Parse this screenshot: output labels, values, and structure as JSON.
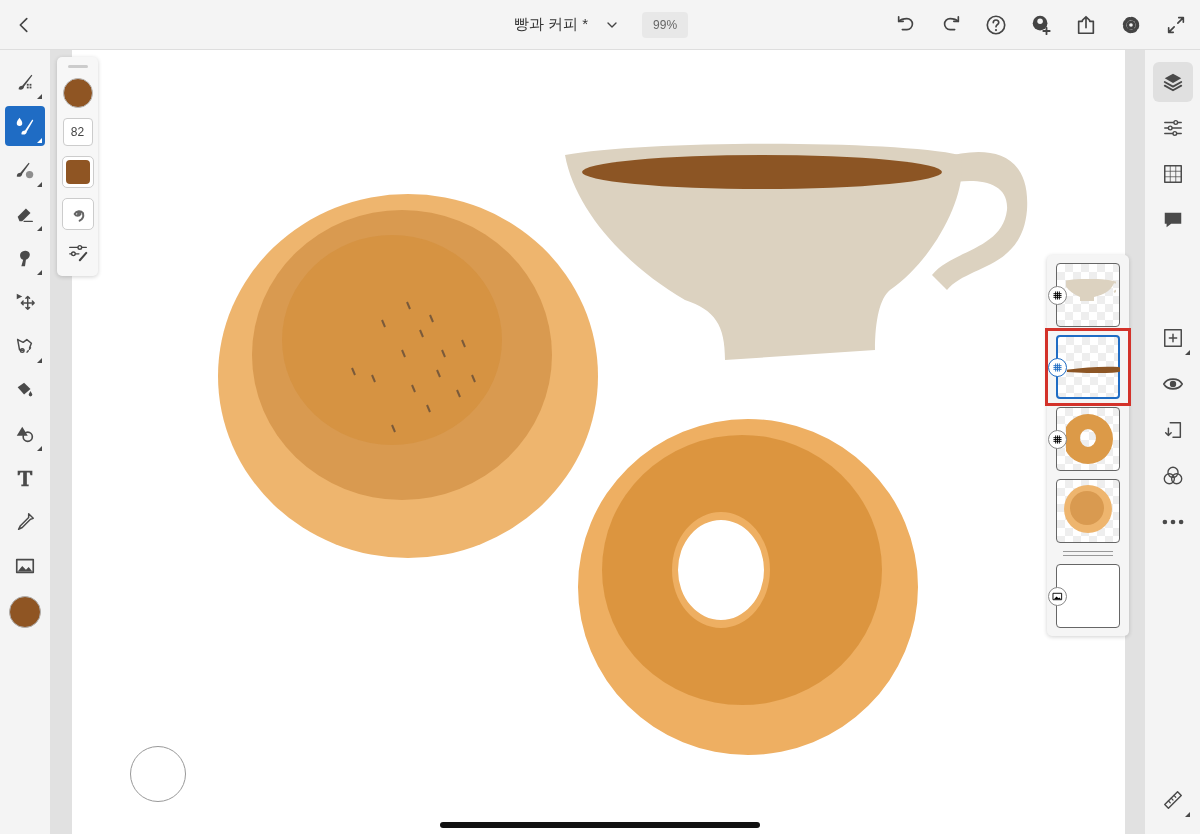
{
  "document": {
    "title": "빵과 커피 *",
    "zoom": "99%"
  },
  "tools": [
    {
      "kind": "pixel-brush",
      "selected": false,
      "submenu": true
    },
    {
      "kind": "live-brush",
      "selected": true,
      "submenu": true
    },
    {
      "kind": "vector-brush",
      "selected": false,
      "submenu": true
    },
    {
      "kind": "eraser",
      "selected": false,
      "submenu": true
    },
    {
      "kind": "smudge",
      "selected": false,
      "submenu": true
    },
    {
      "kind": "move",
      "selected": false,
      "submenu": false
    },
    {
      "kind": "lasso",
      "selected": false,
      "submenu": true
    },
    {
      "kind": "fill",
      "selected": false,
      "submenu": false
    },
    {
      "kind": "shapes",
      "selected": false,
      "submenu": true
    },
    {
      "kind": "text",
      "selected": false,
      "submenu": false
    },
    {
      "kind": "eyedropper",
      "selected": false,
      "submenu": false
    },
    {
      "kind": "image",
      "selected": false,
      "submenu": false
    }
  ],
  "brush_size": "82",
  "layers": [
    {
      "kind": "cup",
      "selected": false
    },
    {
      "kind": "stroke",
      "selected": true
    },
    {
      "kind": "donut",
      "selected": false
    },
    {
      "kind": "bread",
      "selected": false
    },
    {
      "kind": "background",
      "selected": false
    }
  ],
  "panel_tools": [
    {
      "kind": "layers",
      "selected": true
    },
    {
      "kind": "adjust",
      "selected": false
    },
    {
      "kind": "grid",
      "selected": false
    },
    {
      "kind": "comment",
      "selected": false
    }
  ],
  "layer_tools": [
    {
      "kind": "add-layer",
      "submenu": true
    },
    {
      "kind": "eye",
      "submenu": false
    },
    {
      "kind": "import",
      "submenu": false
    },
    {
      "kind": "blend",
      "submenu": false
    },
    {
      "kind": "more",
      "submenu": false
    }
  ]
}
